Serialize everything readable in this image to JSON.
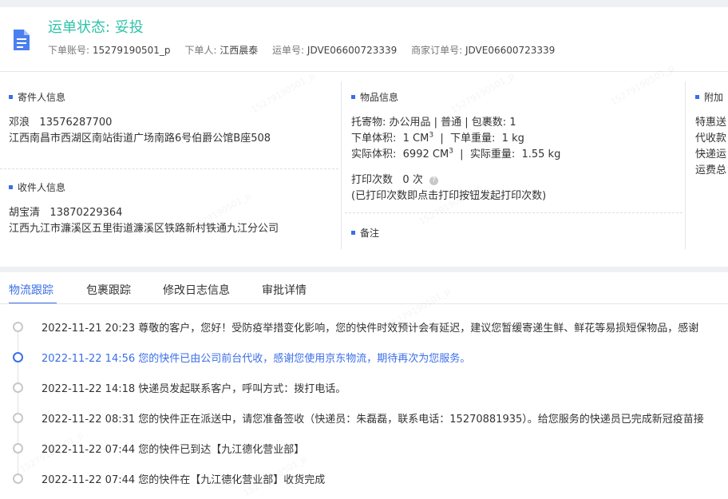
{
  "header": {
    "status_label": "运单状态:",
    "status_value": "妥投",
    "order_account_label": "下单账号:",
    "order_account": "15279190501_p",
    "orderer_label": "下单人:",
    "orderer": "江西晨泰",
    "waybill_label": "运单号:",
    "waybill": "JDVE06600723339",
    "merchant_order_label": "商家订单号:",
    "merchant_order": "JDVE06600723339"
  },
  "sender": {
    "title": "寄件人信息",
    "name": "邓浪",
    "phone": "13576287700",
    "address": "江西南昌市西湖区南站街道广场南路6号伯爵公馆B座508"
  },
  "receiver": {
    "title": "收件人信息",
    "name": "胡宝清",
    "phone": "13870229364",
    "address": "江西九江市濂溪区五里街道濂溪区铁路新村铁通九江分公司"
  },
  "goods": {
    "title": "物品信息",
    "line1": "托寄物:  办公用品 | 普通  |  包裹数:  1",
    "order_volume_label": "下单体积:",
    "order_volume": "1 CM",
    "order_weight_label": "下单重量:",
    "order_weight": "1 kg",
    "actual_volume_label": "实际体积:",
    "actual_volume": "6992 CM",
    "actual_weight_label": "实际重量:",
    "actual_weight": "1.55 kg",
    "unit_sup": "3",
    "print_label": "打印次数",
    "print_count": "0 次",
    "print_note": "(已打印次数即点击打印按钮发起打印次数)",
    "remarks_title": "备注"
  },
  "extra": {
    "title": "附加",
    "lines": [
      "特惠送",
      "代收款",
      "快递运",
      "运费总"
    ]
  },
  "tabs": [
    "物流跟踪",
    "包裹跟踪",
    "修改日志信息",
    "审批详情"
  ],
  "timeline": [
    "2022-11-21 20:23 尊敬的客户，您好！受防疫举措变化影响，您的快件时效预计会有延迟，建议您暂缓寄递生鲜、鲜花等易损短保物品，感谢",
    "2022-11-22 14:56 您的快件已由公司前台代收，感谢您使用京东物流，期待再次为您服务。",
    "2022-11-22 14:18 快递员发起联系客户，呼叫方式：拨打电话。",
    "2022-11-22 08:31 您的快件正在派送中，请您准备签收（快递员：朱磊磊，联系电话：15270881935）。给您服务的快递员已完成新冠疫苗接",
    "2022-11-22 07:44 您的快件已到达【九江德化营业部】",
    "2022-11-22 07:44 您的快件在【九江德化营业部】收货完成"
  ],
  "watermark": "15279190501_p",
  "colors": {
    "accent": "#3b6ee8",
    "status": "#2fc3a8"
  }
}
